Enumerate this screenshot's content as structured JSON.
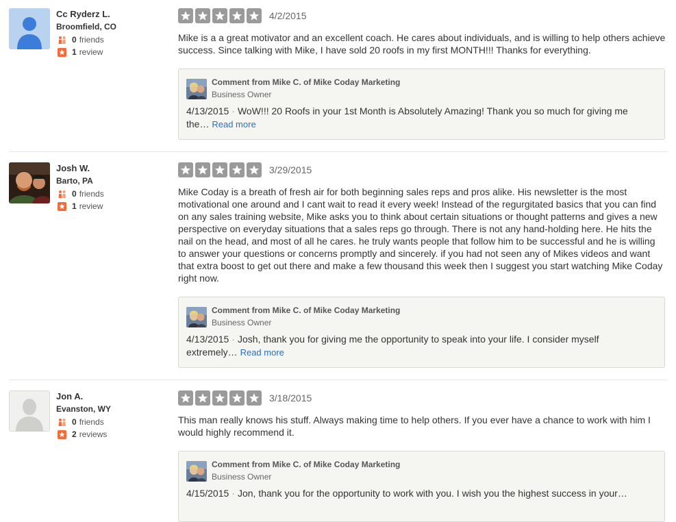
{
  "reviews": [
    {
      "user": {
        "name": "Cc Ryderz L.",
        "location": "Broomfield, CO",
        "friends_count": "0",
        "friends_label": "friends",
        "reviews_count": "1",
        "reviews_label": "review",
        "avatar_icon": "default-user-avatar-icon"
      },
      "rating": 5,
      "date": "4/2/2015",
      "text": "Mike is a a great motivator and an excellent coach. He cares about individuals, and is willing to help others achieve success. Since talking with Mike, I have sold 20 roofs in my first MONTH!!!  Thanks for everything.",
      "comment": {
        "from": "Comment from Mike C. of Mike Coday Marketing",
        "role": "Business Owner",
        "date": "4/13/2015",
        "separator": "·",
        "text": "WoW!!! 20 Roofs in your 1st Month is Absolutely Amazing! Thank you so much for giving me the…",
        "read_more": "Read more"
      }
    },
    {
      "user": {
        "name": "Josh W.",
        "location": "Barto, PA",
        "friends_count": "0",
        "friends_label": "friends",
        "reviews_count": "1",
        "reviews_label": "review",
        "avatar_icon": "user-photo-avatar"
      },
      "rating": 5,
      "date": "3/29/2015",
      "text": "Mike Coday is a breath of fresh air for both beginning sales reps and pros alike. His newsletter is the most motivational one around and I cant wait to read it every week! Instead of the regurgitated basics that you can find on any sales training website, Mike asks you to think about certain situations or thought patterns and gives a new perspective on everyday situations that a sales reps go through. There is not any hand-holding here. He hits the nail on the head, and most of all he cares. he truly wants people that follow him to be successful and he is willing to answer your questions or concerns promptly and sincerely.  if you had not seen any of Mikes videos and want that extra boost to get out there and make a few thousand this week then I suggest you start watching Mike Coday right now.",
      "comment": {
        "from": "Comment from Mike C. of Mike Coday Marketing",
        "role": "Business Owner",
        "date": "4/13/2015",
        "separator": "·",
        "text": "Josh, thank you for giving me the opportunity to speak into your life. I consider myself extremely…",
        "read_more": "Read more"
      }
    },
    {
      "user": {
        "name": "Jon A.",
        "location": "Evanston, WY",
        "friends_count": "0",
        "friends_label": "friends",
        "reviews_count": "2",
        "reviews_label": "reviews",
        "avatar_icon": "default-user-silhouette-icon"
      },
      "rating": 5,
      "date": "3/18/2015",
      "text": "This man really knows his stuff. Always making time to help others. If you ever have a chance to work with him I would highly recommend it.",
      "comment": {
        "from": "Comment from Mike C. of Mike Coday Marketing",
        "role": "Business Owner",
        "date": "4/15/2015",
        "separator": "·",
        "text": "Jon, thank you for the opportunity to work with you. I wish you the highest success in your…",
        "read_more": ""
      }
    }
  ],
  "colors": {
    "star_bg": "#9a9a9a",
    "link": "#2f6fb6",
    "friends_icon": "#f26b3a",
    "review_icon": "#f26b3a",
    "comment_bg": "#f5f5f1"
  }
}
